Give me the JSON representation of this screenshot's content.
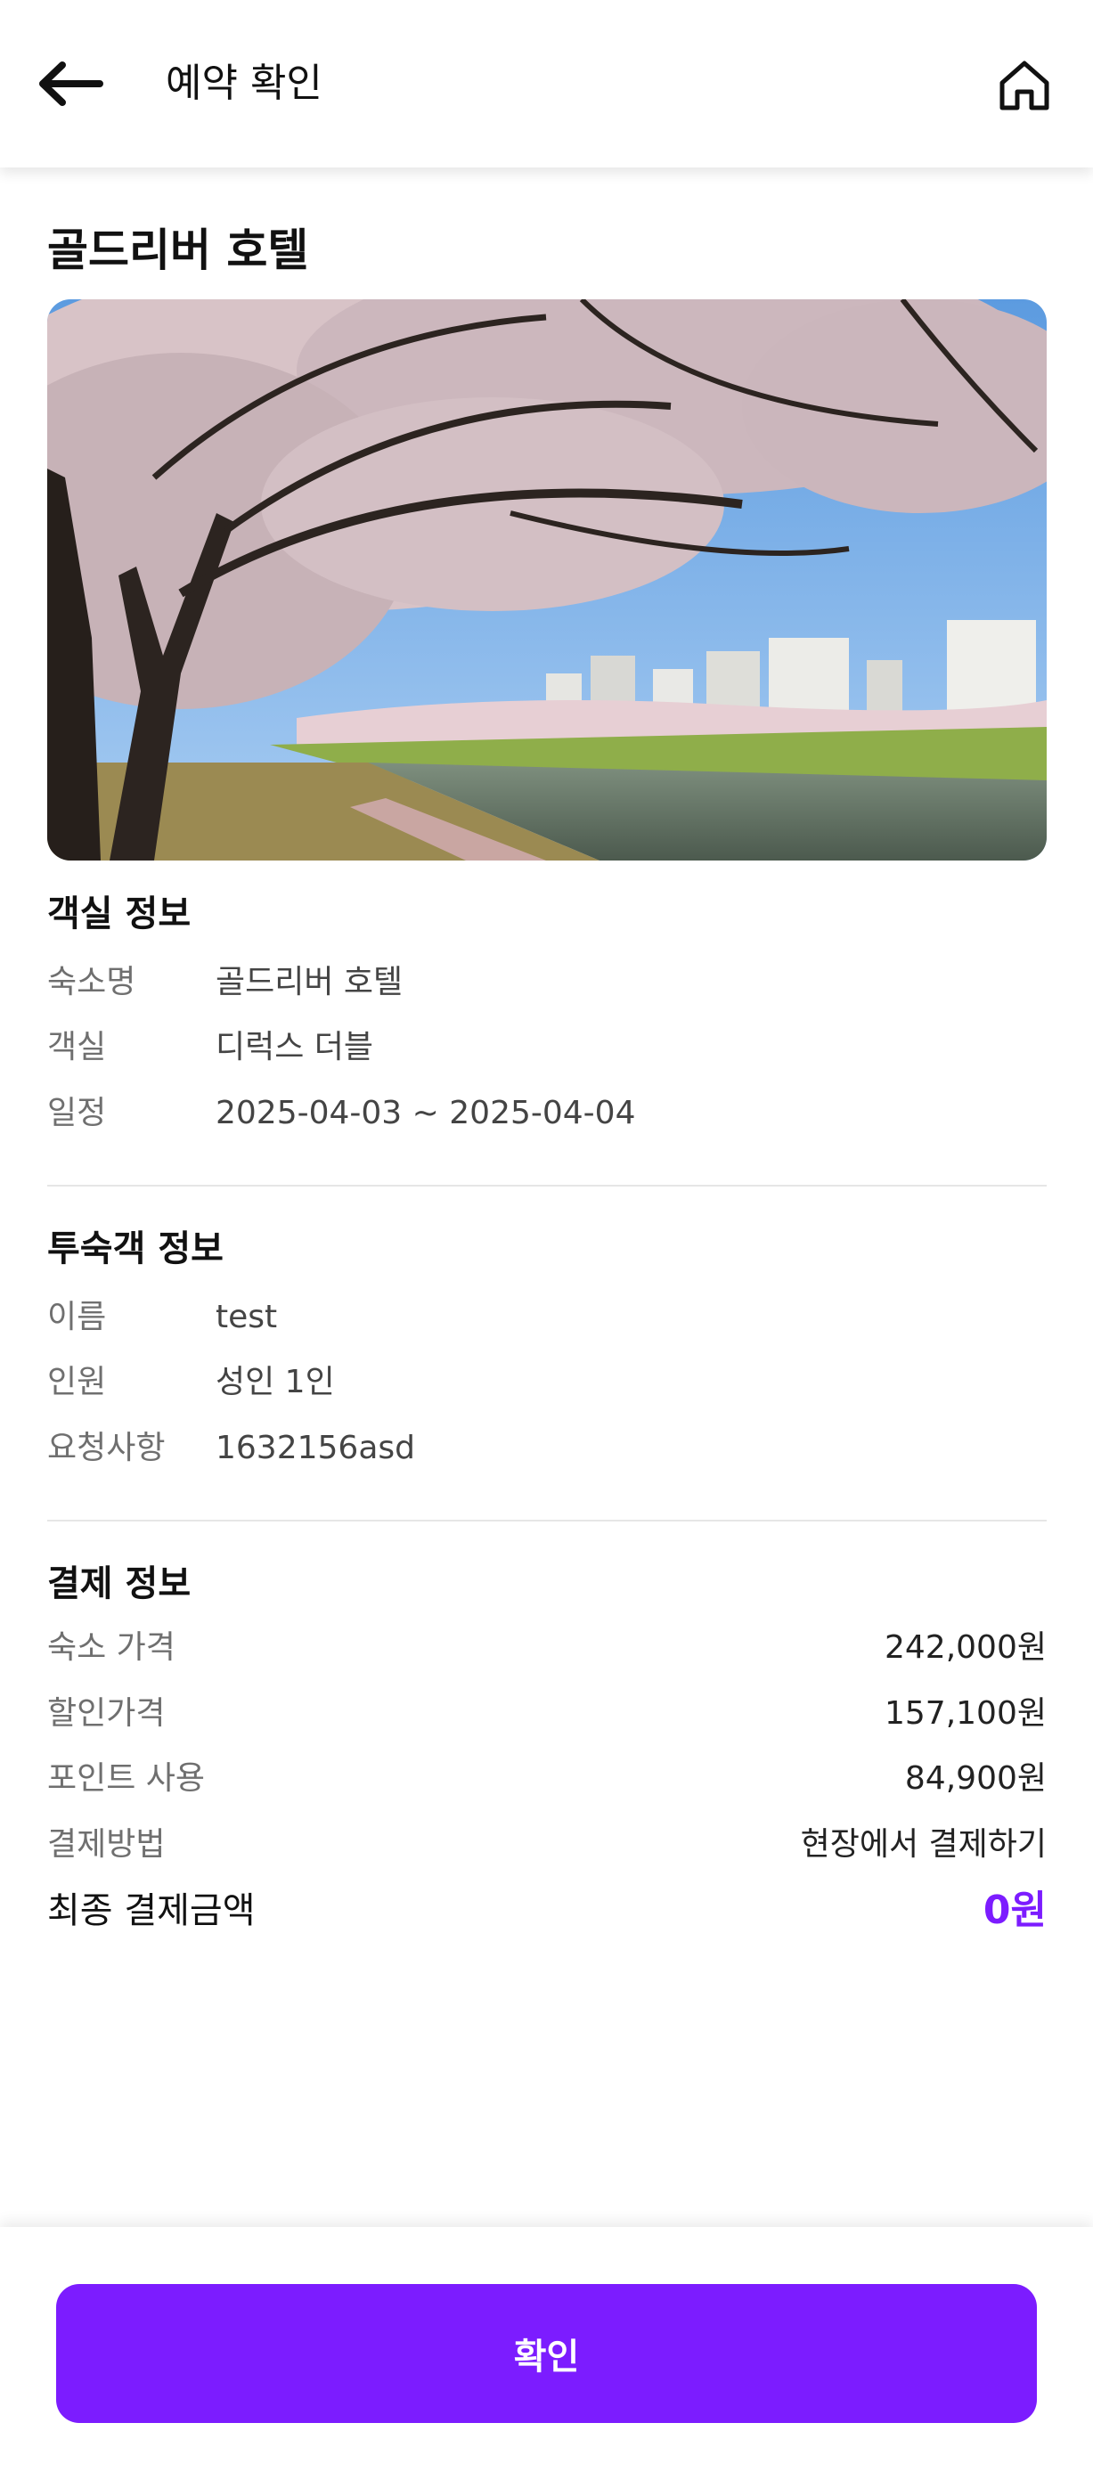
{
  "header": {
    "title": "예약 확인",
    "back_icon": "arrow-left-icon",
    "home_icon": "home-icon"
  },
  "hotel": {
    "name": "골드리버 호텔",
    "photo_icon": "hotel-photo-cherry-blossom-river"
  },
  "room_info": {
    "title": "객실 정보",
    "rows": [
      {
        "label": "숙소명",
        "value": "골드리버 호텔"
      },
      {
        "label": "객실",
        "value": "디럭스 더블"
      },
      {
        "label": "일정",
        "value": "2025-04-03 ~ 2025-04-04"
      }
    ]
  },
  "guest_info": {
    "title": "투숙객 정보",
    "rows": [
      {
        "label": "이름",
        "value": "test"
      },
      {
        "label": "인원",
        "value": "성인 1인"
      },
      {
        "label": "요청사항",
        "value": "1632156asd"
      }
    ]
  },
  "payment_info": {
    "title": "결제 정보",
    "rows": [
      {
        "label": "숙소 가격",
        "value": "242,000원"
      },
      {
        "label": "할인가격",
        "value": "157,100원"
      },
      {
        "label": "포인트 사용",
        "value": "84,900원"
      },
      {
        "label": "결제방법",
        "value": "현장에서 결제하기"
      }
    ],
    "final_label": "최종 결제금액",
    "final_value": "0원"
  },
  "footer": {
    "confirm_label": "확인"
  },
  "colors": {
    "accent": "#7c1cff",
    "label_gray": "#6f6f6f",
    "value_gray": "#444444",
    "divider": "#e6e6e6"
  }
}
